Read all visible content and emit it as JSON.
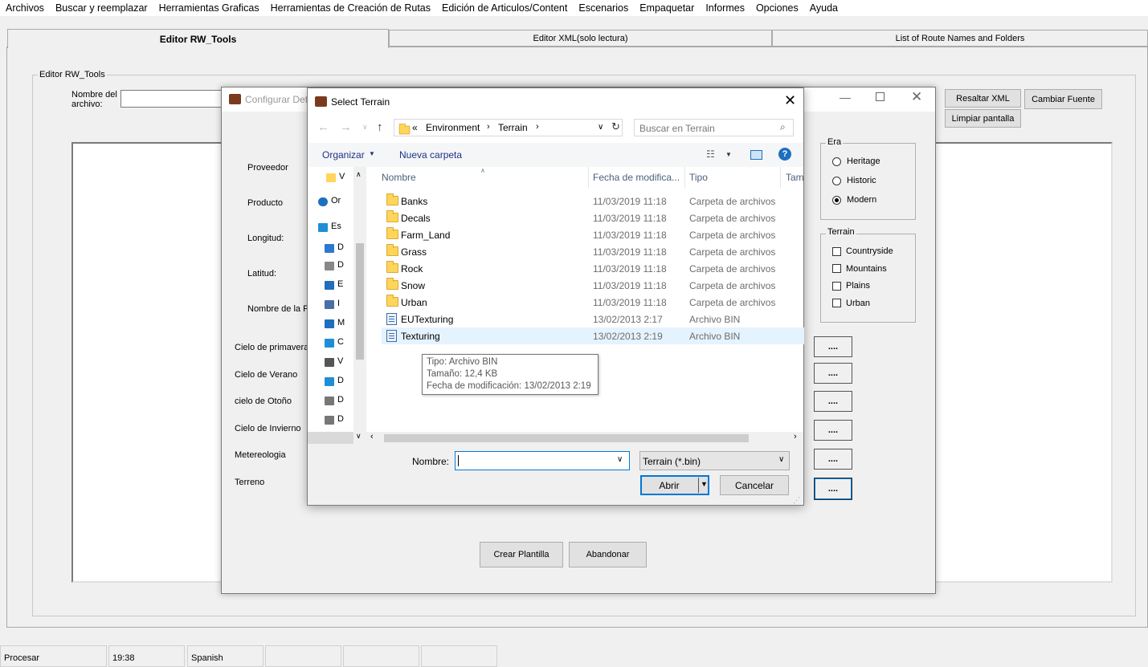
{
  "menu": [
    "Archivos",
    "Buscar y reemplazar",
    "Herramientas Graficas",
    "Herramientas de Creación de Rutas",
    "Edición de Articulos/Content",
    "Escenarios",
    "Empaquetar",
    "Informes",
    "Opciones",
    "Ayuda"
  ],
  "tabs": [
    "Editor RW_Tools",
    "Editor XML(solo lectura)",
    "List of Route Names and Folders"
  ],
  "editor": {
    "group_title": "Editor RW_Tools",
    "filename_label": "Nombre del archivo:",
    "highlight_button": "Resaltar XML",
    "change_font_button": "Cambiar Fuente",
    "clear_button": "Limpiar pantalla"
  },
  "config_dialog": {
    "title": "Configurar Det",
    "labels": [
      "Proveedor",
      "Producto",
      "Longitud:",
      "Latitud:",
      "Nombre de la Pl",
      "Cielo de primavera",
      "Cielo de Verano",
      "cielo de Otoño",
      "Cielo de Invierno",
      "Metereologia",
      "Terreno"
    ],
    "browse_label": "....",
    "era": {
      "title": "Era",
      "options": [
        "Heritage",
        "Historic",
        "Modern"
      ],
      "selected": "Modern"
    },
    "terrain": {
      "title": "Terrain",
      "options": [
        "Countryside",
        "Mountains",
        "Plains",
        "Urban"
      ]
    },
    "create_button": "Crear Plantilla",
    "abandon_button": "Abandonar"
  },
  "select_dialog": {
    "title": "Select Terrain",
    "breadcrumb": [
      "«",
      "Environment",
      "Terrain"
    ],
    "search_placeholder": "Buscar en Terrain",
    "organize": "Organizar",
    "new_folder": "Nueva carpeta",
    "columns": [
      "Nombre",
      "Fecha de modifica...",
      "Tipo",
      "Tam"
    ],
    "nav_items": [
      "V",
      "Or",
      "Es",
      "D",
      "D",
      "E",
      "I",
      "M",
      "C",
      "V",
      "D",
      "D",
      "D"
    ],
    "files": [
      {
        "name": "Banks",
        "date": "11/03/2019 11:18",
        "type": "Carpeta de archivos",
        "kind": "folder"
      },
      {
        "name": "Decals",
        "date": "11/03/2019 11:18",
        "type": "Carpeta de archivos",
        "kind": "folder"
      },
      {
        "name": "Farm_Land",
        "date": "11/03/2019 11:18",
        "type": "Carpeta de archivos",
        "kind": "folder"
      },
      {
        "name": "Grass",
        "date": "11/03/2019 11:18",
        "type": "Carpeta de archivos",
        "kind": "folder"
      },
      {
        "name": "Rock",
        "date": "11/03/2019 11:18",
        "type": "Carpeta de archivos",
        "kind": "folder"
      },
      {
        "name": "Snow",
        "date": "11/03/2019 11:18",
        "type": "Carpeta de archivos",
        "kind": "folder"
      },
      {
        "name": "Urban",
        "date": "11/03/2019 11:18",
        "type": "Carpeta de archivos",
        "kind": "folder"
      },
      {
        "name": "EUTexturing",
        "date": "13/02/2013 2:17",
        "type": "Archivo BIN",
        "kind": "bin"
      },
      {
        "name": "Texturing",
        "date": "13/02/2013 2:19",
        "type": "Archivo BIN",
        "kind": "bin"
      }
    ],
    "tooltip": [
      "Tipo: Archivo BIN",
      "Tamaño: 12,4 KB",
      "Fecha de modificación: 13/02/2013 2:19"
    ],
    "filename_label": "Nombre:",
    "filename_value": "",
    "filter": "Terrain (*.bin)",
    "open_button": "Abrir",
    "cancel_button": "Cancelar"
  },
  "status": [
    "Procesar",
    "19:38",
    "Spanish",
    "",
    "",
    ""
  ]
}
